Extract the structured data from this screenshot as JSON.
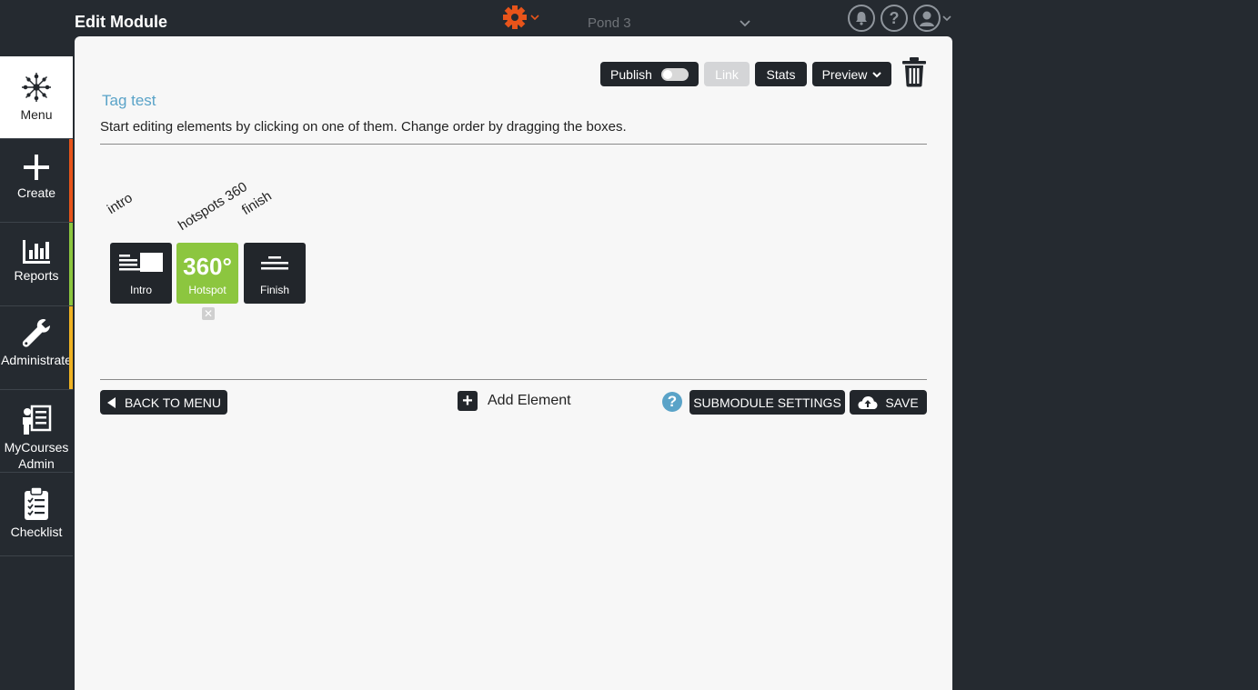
{
  "header": {
    "title": "Edit Module",
    "org_select": "Pond 3",
    "accent": "#e8541a"
  },
  "sidebar": {
    "items": [
      {
        "label": "Menu",
        "icon": "snowflake-icon",
        "accent": ""
      },
      {
        "label": "Create",
        "icon": "plus-icon",
        "accent": "#e8541a"
      },
      {
        "label": "Reports",
        "icon": "bar-chart-icon",
        "accent": "#8cc63f"
      },
      {
        "label": "Administrate",
        "icon": "wrench-icon",
        "accent": "#f0b323"
      },
      {
        "label": "MyCourses Admin",
        "label_line1": "MyCourses",
        "label_line2": "Admin",
        "icon": "presenter-icon",
        "accent": ""
      },
      {
        "label": "Checklist",
        "icon": "clipboard-icon",
        "accent": ""
      }
    ]
  },
  "toolbar": {
    "publish": "Publish",
    "publish_state": "off",
    "link": "Link",
    "stats": "Stats",
    "preview": "Preview"
  },
  "module": {
    "name": "Tag test",
    "instructions": "Start editing elements by clicking on one of them. Change order by dragging the boxes."
  },
  "elements": [
    {
      "label": "intro",
      "tile_text": "Intro",
      "type": "intro",
      "color": "#22262b"
    },
    {
      "label": "hotspots 360",
      "tile_text": "Hotspot",
      "big_text": "360°",
      "type": "hotspot",
      "color": "#8cc63f"
    },
    {
      "label": "finish",
      "tile_text": "Finish",
      "type": "finish",
      "color": "#22262b"
    }
  ],
  "footer": {
    "back": "BACK TO MENU",
    "add_element": "Add Element",
    "submodule_settings": "SUBMODULE SETTINGS",
    "save": "SAVE"
  }
}
